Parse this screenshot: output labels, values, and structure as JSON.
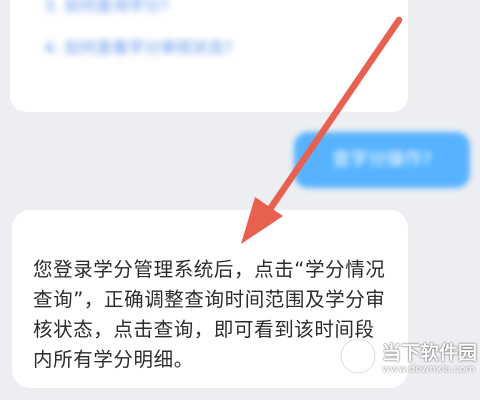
{
  "chat": {
    "faq_links": [
      "3. 如何查询学分?",
      "4. 如何查看学分审核状态?"
    ],
    "user_message": "查学分操作?",
    "answer": "您登录学分管理系统后，点击“学分情况查询”，正确调整查询时间范围及学分审核状态，点击查询，即可看到该时间段内所有学分明细。"
  },
  "annotation": {
    "arrow_color": "#e8604f"
  },
  "watermark": {
    "title": "当下软件园",
    "url": "www.downxia.com"
  },
  "colors": {
    "background": "#eceef2",
    "link": "#4a86e8",
    "user_bubble": "#57b3ff",
    "bubble": "#ffffff"
  }
}
